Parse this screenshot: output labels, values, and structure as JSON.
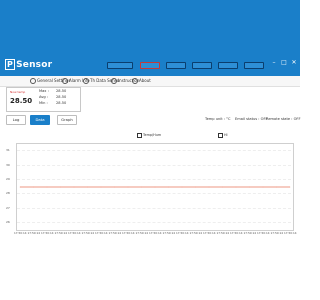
{
  "app": {
    "logo_mark": "P",
    "logo_text": "Sensor",
    "window_controls": [
      "minimize-icon",
      "maximize-icon",
      "close-icon"
    ]
  },
  "menu": {
    "items": [
      {
        "label": "General Settings",
        "icon": "gear-icon"
      },
      {
        "label": "Alarm Info",
        "icon": "bell-icon"
      },
      {
        "label": "Th Data Sensor",
        "icon": "sensor-icon"
      },
      {
        "label": "Instruction",
        "icon": "info-icon"
      },
      {
        "label": "About",
        "icon": "about-icon"
      }
    ]
  },
  "current": {
    "label": "Now temp",
    "value": "28.50",
    "stats": [
      {
        "key": "Max :",
        "value": "28.50"
      },
      {
        "key": "Avg :",
        "value": "28.50"
      },
      {
        "key": "Min :",
        "value": "28.50"
      }
    ]
  },
  "controls": {
    "buttons": [
      {
        "label": "Log",
        "active": false
      },
      {
        "label": "Data",
        "active": true
      },
      {
        "label": "Graph",
        "active": false
      }
    ],
    "status": {
      "temp_unit": "Temp unit : °C",
      "email": "Email status : OFF",
      "remote": "Remote state : OFF"
    }
  },
  "legend": {
    "series_label": "Temp/Hum",
    "second_label": "HI"
  },
  "colors": {
    "brand": "#1a7fc9",
    "series": "#e8745a",
    "alert": "#d32f2f"
  },
  "chart_data": {
    "type": "line",
    "x": [
      "17:50:14",
      "17:50:14",
      "17:50:14",
      "17:50:14",
      "17:50:14",
      "17:50:14",
      "17:50:14",
      "17:50:14",
      "17:50:14",
      "17:50:14",
      "17:50:14",
      "17:50:14",
      "17:50:14",
      "17:50:14",
      "17:50:14",
      "17:50:14",
      "17:50:14",
      "17:50:14",
      "17:50:14",
      "17:50:14",
      "17:50:14"
    ],
    "series": [
      {
        "name": "Temp/Hum",
        "values": [
          28.5,
          28.5,
          28.5,
          28.5,
          28.5,
          28.5,
          28.5,
          28.5,
          28.5,
          28.5,
          28.5,
          28.5,
          28.5,
          28.5,
          28.5,
          28.5,
          28.5,
          28.5,
          28.5,
          28.5,
          28.5
        ]
      }
    ],
    "yticks": [
      31,
      30,
      29,
      28,
      27,
      26
    ],
    "ylim": [
      25.5,
      31.5
    ],
    "grid": true
  }
}
